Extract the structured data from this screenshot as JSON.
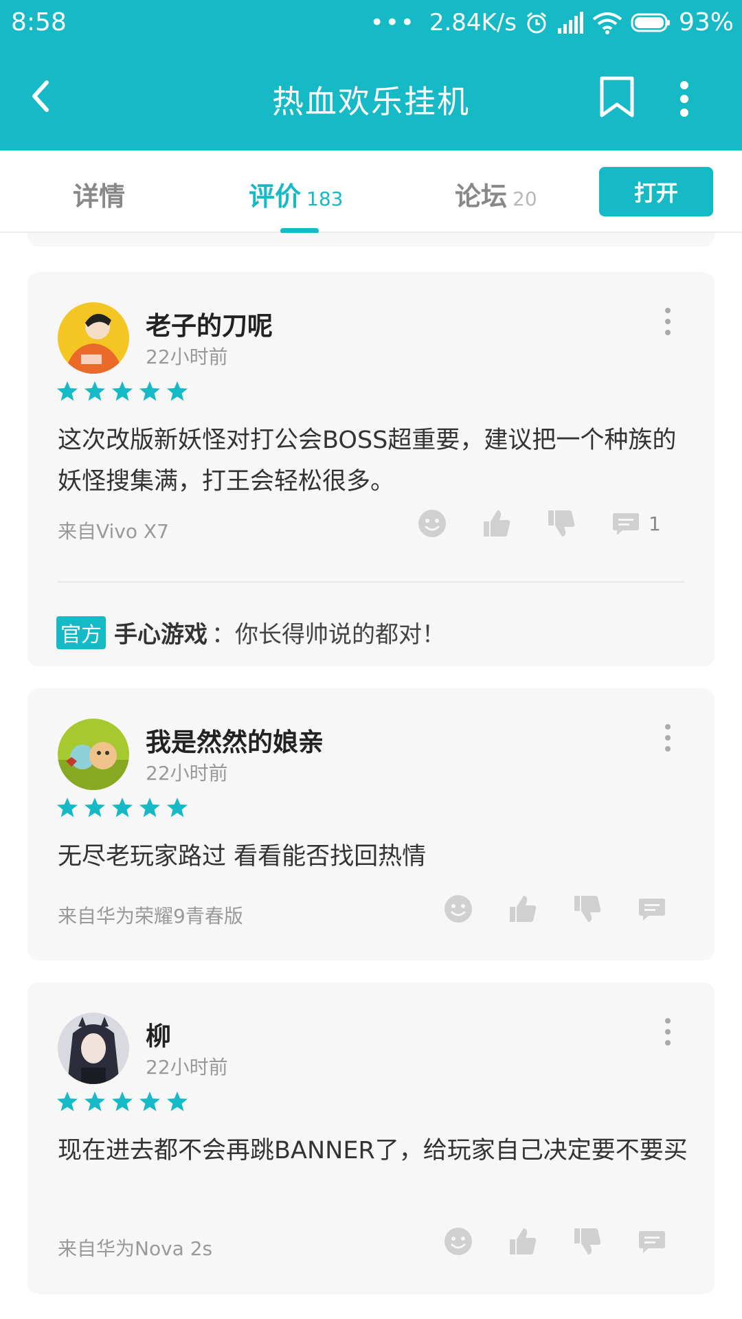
{
  "status": {
    "time": "8:58",
    "dots": "•••",
    "speed": "2.84K/s",
    "battery": "93%"
  },
  "appbar": {
    "title": "热血欢乐挂机"
  },
  "tabs": [
    {
      "label": "详情",
      "count": ""
    },
    {
      "label": "评价",
      "count": "183"
    },
    {
      "label": "论坛",
      "count": "20"
    }
  ],
  "open_button": "打开",
  "reviews": [
    {
      "user": "老子的刀呢",
      "time": "22小时前",
      "rating": 5,
      "text": "这次改版新妖怪对打公会BOSS超重要，建议把一个种族的妖怪搜集满，打王会轻松很多。",
      "device": "来自Vivo X7",
      "comments": "1",
      "reply": {
        "badge": "官方",
        "author": "手心游戏",
        "sep": "：",
        "text": "你长得帅说的都对！"
      }
    },
    {
      "user": "我是然然的娘亲",
      "time": "22小时前",
      "rating": 5,
      "text": "无尽老玩家路过 看看能否找回热情",
      "device": "来自华为荣耀9青春版",
      "comments": ""
    },
    {
      "user": "柳",
      "time": "22小时前",
      "rating": 5,
      "text": "现在进去都不会再跳BANNER了，给玩家自己决定要不要买",
      "device": "来自华为Nova 2s",
      "comments": ""
    }
  ],
  "colors": {
    "accent": "#16b9c6",
    "card": "#f7f7f7"
  }
}
